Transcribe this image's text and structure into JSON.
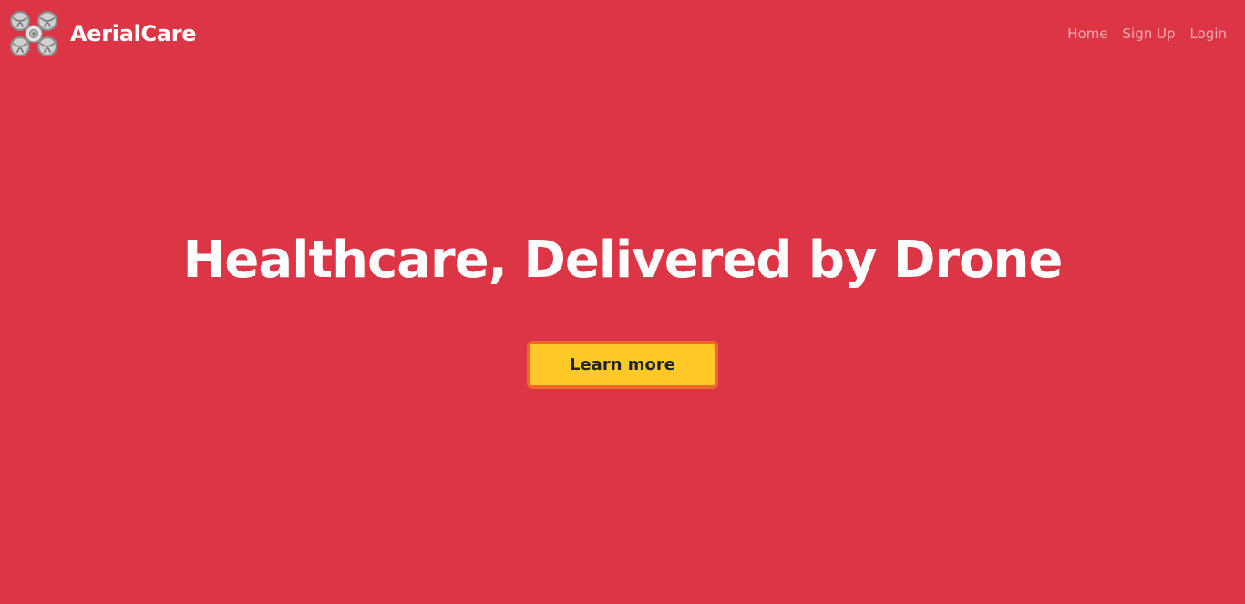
{
  "navbar": {
    "logo_icon": "drone-icon",
    "brand_name": "AerialCare",
    "links": [
      {
        "label": "Home"
      },
      {
        "label": "Sign Up"
      },
      {
        "label": "Login"
      }
    ]
  },
  "hero": {
    "title": "Healthcare, Delivered by Drone",
    "cta_label": "Learn more"
  },
  "colors": {
    "background": "#dc3545",
    "cta_background": "#ffc928",
    "cta_border": "#ee6a2a",
    "cta_text": "#212529",
    "nav_link": "rgba(255,255,255,0.58)"
  }
}
